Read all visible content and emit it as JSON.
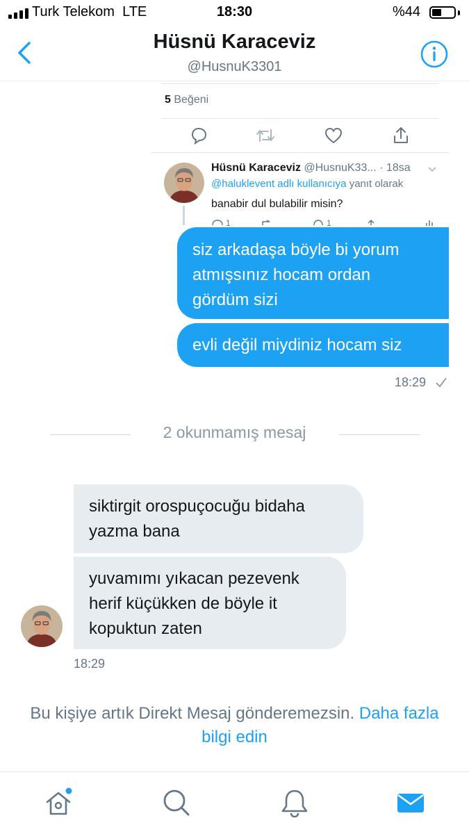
{
  "status_bar": {
    "carrier": "Turk Telekom",
    "network": "LTE",
    "time": "18:30",
    "battery": "%44",
    "battery_level": 0.44
  },
  "header": {
    "title": "Hüsnü Karaceviz",
    "handle": "@HusnuK3301",
    "back_icon": "chevron-left-icon",
    "info_icon": "info-icon"
  },
  "quoted_tweet": {
    "likes_count": "5",
    "likes_label": "Beğeni",
    "actions": [
      "reply-icon",
      "retweet-icon",
      "like-icon",
      "share-icon"
    ],
    "reply": {
      "name": "Hüsnü Karaceviz",
      "handle": "@HusnuK33...",
      "time": "· 18sa",
      "mention": "@haluklevent adlı kullanıcıya",
      "reply_suffix": "yanıt olarak",
      "text": "banabir dul bulabilir misin?"
    }
  },
  "conversation": {
    "sent_messages": [
      {
        "lines": [
          "siz arkadaşa böyle bi yorum",
          "atmışsınız hocam ordan",
          "gördüm sizi"
        ]
      },
      {
        "lines": [
          "evli değil miydiniz hocam siz"
        ]
      }
    ],
    "sent_time": "18:29",
    "unread_label": "2 okunmamış mesaj",
    "received_messages": [
      {
        "lines": [
          "siktirgit orospuçocuğu bidaha",
          "yazma bana"
        ]
      },
      {
        "lines": [
          "yuvamımı yıkacan pezevenk",
          "herif küçükken de böyle it",
          "kopuktun zaten"
        ]
      }
    ],
    "received_time": "18:29"
  },
  "notice": {
    "text": "Bu kişiye artık Direkt Mesaj gönderemezsin.",
    "link": "Daha fazla bilgi edin"
  },
  "tab_bar": {
    "items": [
      "home-icon",
      "search-icon",
      "notifications-icon",
      "messages-icon"
    ],
    "active": "messages-icon",
    "accent": "#1da1f2",
    "inactive": "#657786"
  }
}
